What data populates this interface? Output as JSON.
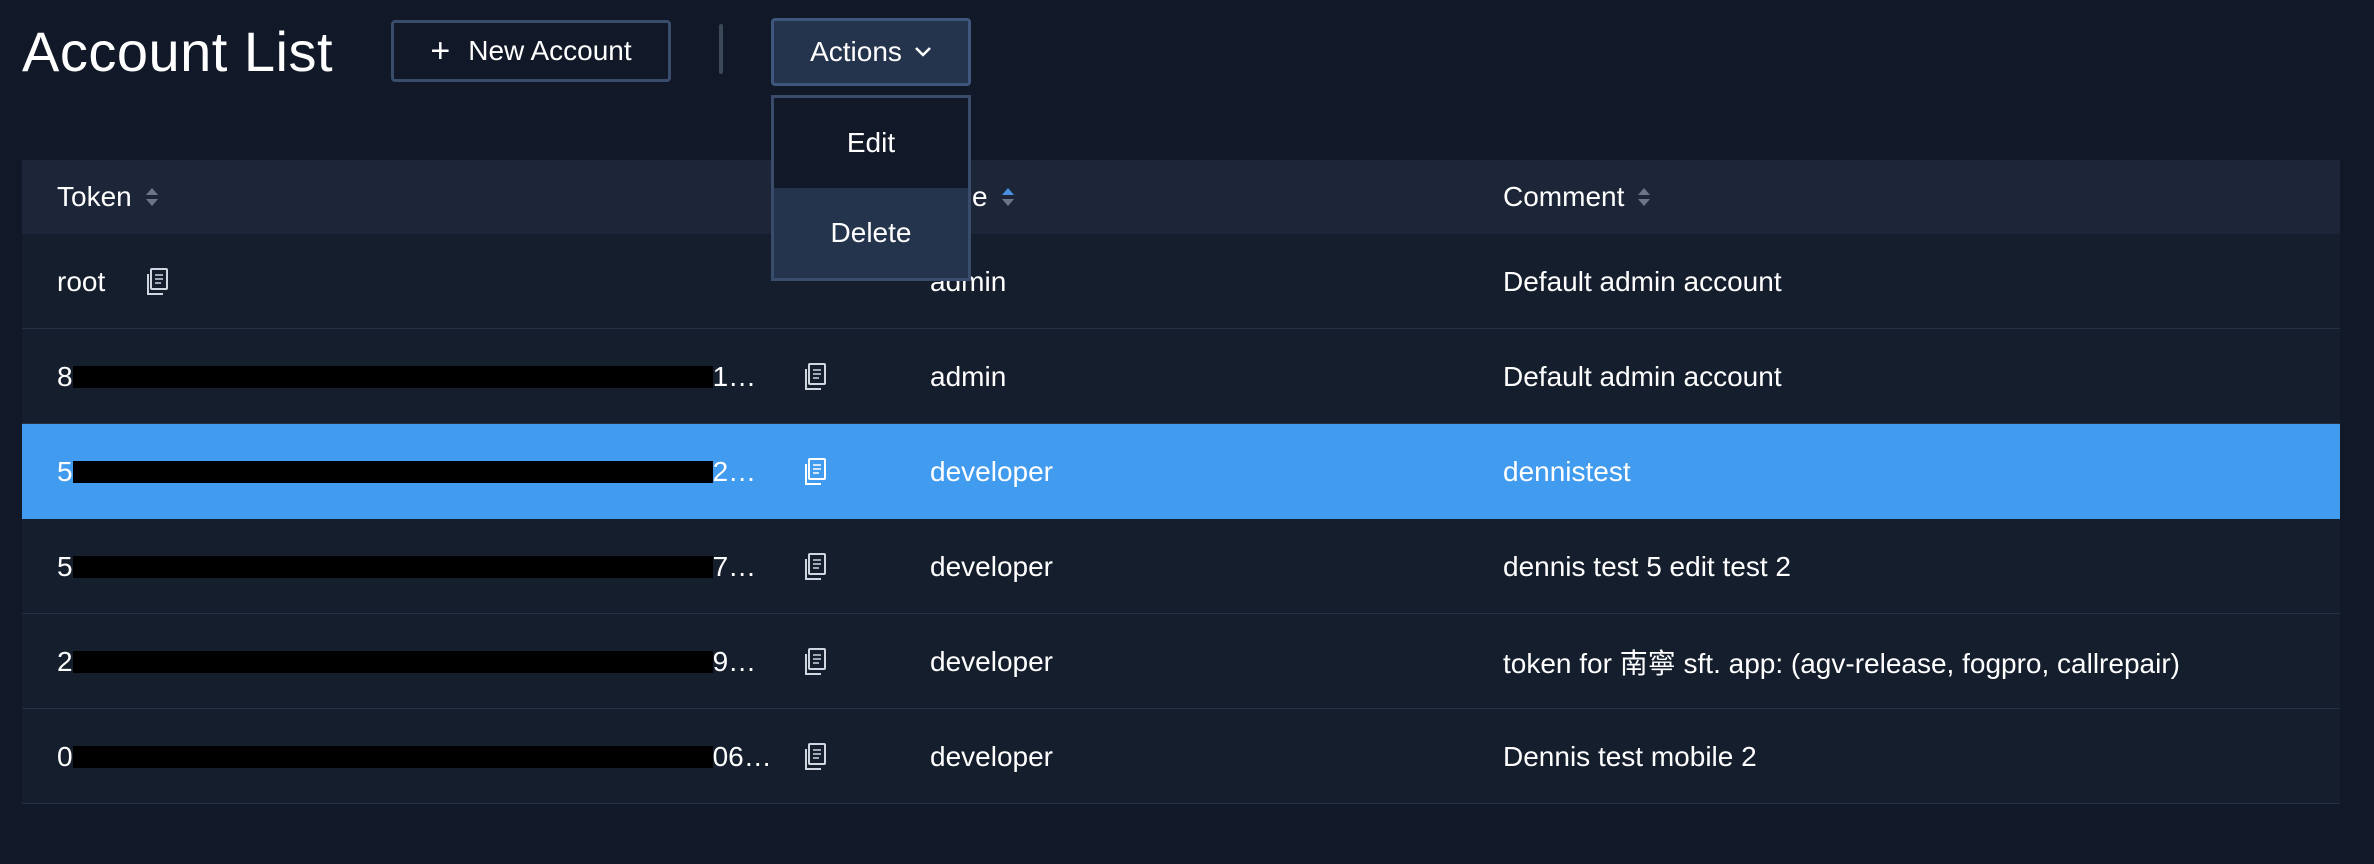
{
  "header": {
    "title": "Account List",
    "new_account_label": "New Account",
    "actions_label": "Actions"
  },
  "actions_menu": {
    "items": [
      {
        "label": "Edit"
      },
      {
        "label": "Delete"
      }
    ]
  },
  "table": {
    "columns": [
      {
        "label": "Token",
        "sort": "none"
      },
      {
        "label": "Role",
        "sort": "ascending"
      },
      {
        "label": "Comment",
        "sort": "none"
      }
    ],
    "rows": [
      {
        "token_start": "root",
        "token_end": "",
        "redacted": false,
        "role": "admin",
        "comment": "Default admin account",
        "selected": false
      },
      {
        "token_start": "8",
        "token_end": "1…",
        "redacted": true,
        "role": "admin",
        "comment": "Default admin account",
        "selected": false
      },
      {
        "token_start": "5",
        "token_end": "2…",
        "redacted": true,
        "role": "developer",
        "comment": "dennistest",
        "selected": true
      },
      {
        "token_start": "5",
        "token_end": "7…",
        "redacted": true,
        "role": "developer",
        "comment": "dennis test 5 edit test 2",
        "selected": false
      },
      {
        "token_start": "2",
        "token_end": "9…",
        "redacted": true,
        "role": "developer",
        "comment": "token for 南寧 sft. app: (agv-release, fogpro, callrepair)",
        "selected": false
      },
      {
        "token_start": "0",
        "token_end": "06…",
        "redacted": true,
        "role": "developer",
        "comment": "Dennis test mobile 2",
        "selected": false
      }
    ]
  },
  "icons": {
    "new_account": "plus-icon",
    "actions": "chevron-down-icon",
    "copy": "copy-icon",
    "sort": "sort-icon"
  },
  "colors": {
    "background": "#111827",
    "header_row": "#1c2638",
    "row": "#151e2d",
    "selected_row": "#419bef",
    "active_sort": "#4a90e2",
    "button_border": "#3a4c6b"
  }
}
